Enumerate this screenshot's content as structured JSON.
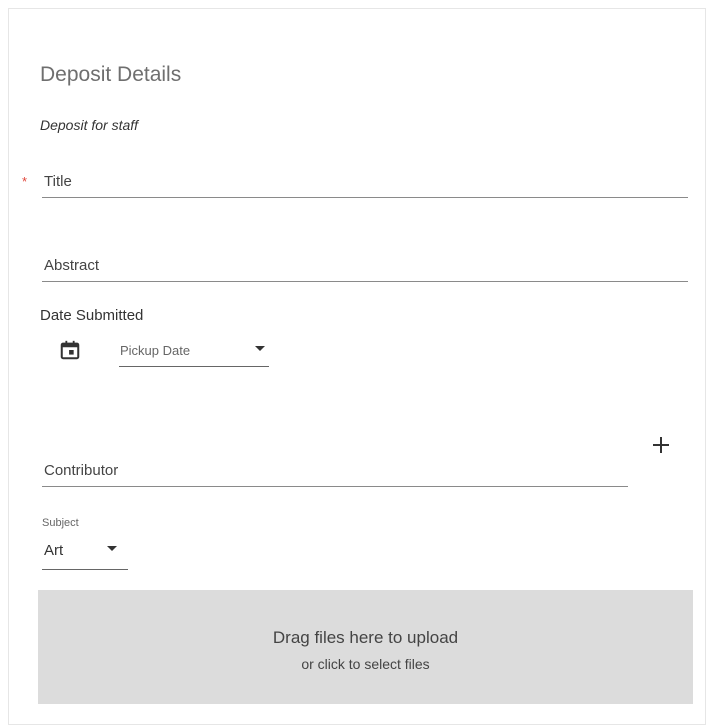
{
  "form": {
    "heading": "Deposit Details",
    "subheading": "Deposit for staff",
    "required_marker": "*",
    "fields": {
      "title": {
        "label": "Title",
        "required": true
      },
      "abstract": {
        "label": "Abstract"
      },
      "date_submitted": {
        "label": "Date Submitted",
        "icon": "calendar-icon",
        "select_value": "Pickup Date"
      },
      "contributor": {
        "label": "Contributor",
        "add_icon": "plus-icon",
        "add_symbol": "+"
      },
      "subject": {
        "label": "Subject",
        "value": "Art"
      }
    },
    "dropzone": {
      "primary_text": "Drag files here to upload",
      "secondary_text": "or click to select files"
    }
  },
  "colors": {
    "required": "#e0453a",
    "dropzone_bg": "#dcdcdc",
    "heading": "#6f6f6f"
  }
}
